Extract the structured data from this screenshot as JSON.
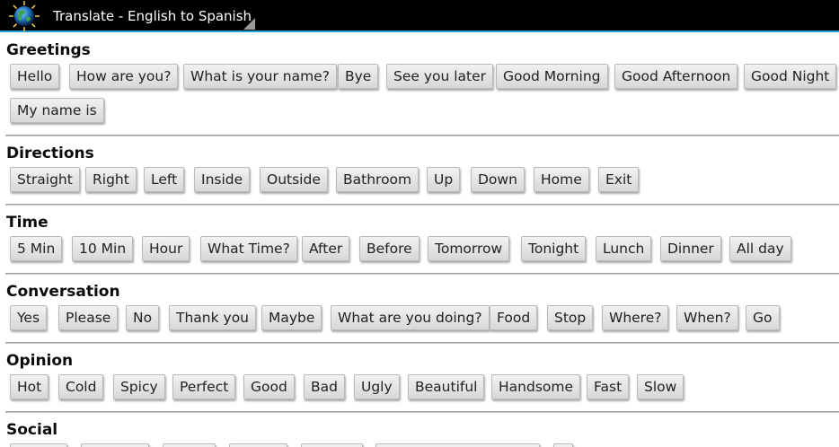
{
  "app": {
    "title": "Translate - English to Spanish",
    "icon": "globe-icon",
    "menu_indicator": "dropdown-corner-icon"
  },
  "colors": {
    "titlebar": "#000000",
    "accent": "#2aa3d6",
    "button_top": "#f2f2f2",
    "button_bottom": "#d8d8d8"
  },
  "sections": [
    {
      "title": "Greetings",
      "buttons": [
        "Hello",
        "How are you?",
        "What is your name?",
        "Bye",
        "See you later",
        "Good Morning",
        "Good Afternoon",
        "Good Night",
        "My name is"
      ]
    },
    {
      "title": "Directions",
      "buttons": [
        "Straight",
        "Right",
        "Left",
        "Inside",
        "Outside",
        "Bathroom",
        "Up",
        "Down",
        "Home",
        "Exit"
      ]
    },
    {
      "title": "Time",
      "buttons": [
        "5 Min",
        "10 Min",
        "Hour",
        "What Time?",
        "After",
        "Before",
        "Tomorrow",
        "Tonight",
        "Lunch",
        "Dinner",
        "All day"
      ]
    },
    {
      "title": "Conversation",
      "buttons": [
        "Yes",
        "Please",
        "No",
        "Thank you",
        "Maybe",
        "What are you doing?",
        "Food",
        "Stop",
        "Where?",
        "When?",
        "Go"
      ]
    },
    {
      "title": "Opinion",
      "buttons": [
        "Hot",
        "Cold",
        "Spicy",
        "Perfect",
        "Good",
        "Bad",
        "Ugly",
        "Beautiful",
        "Handsome",
        "Fast",
        "Slow"
      ]
    },
    {
      "title": "Social",
      "buttons": []
    }
  ]
}
